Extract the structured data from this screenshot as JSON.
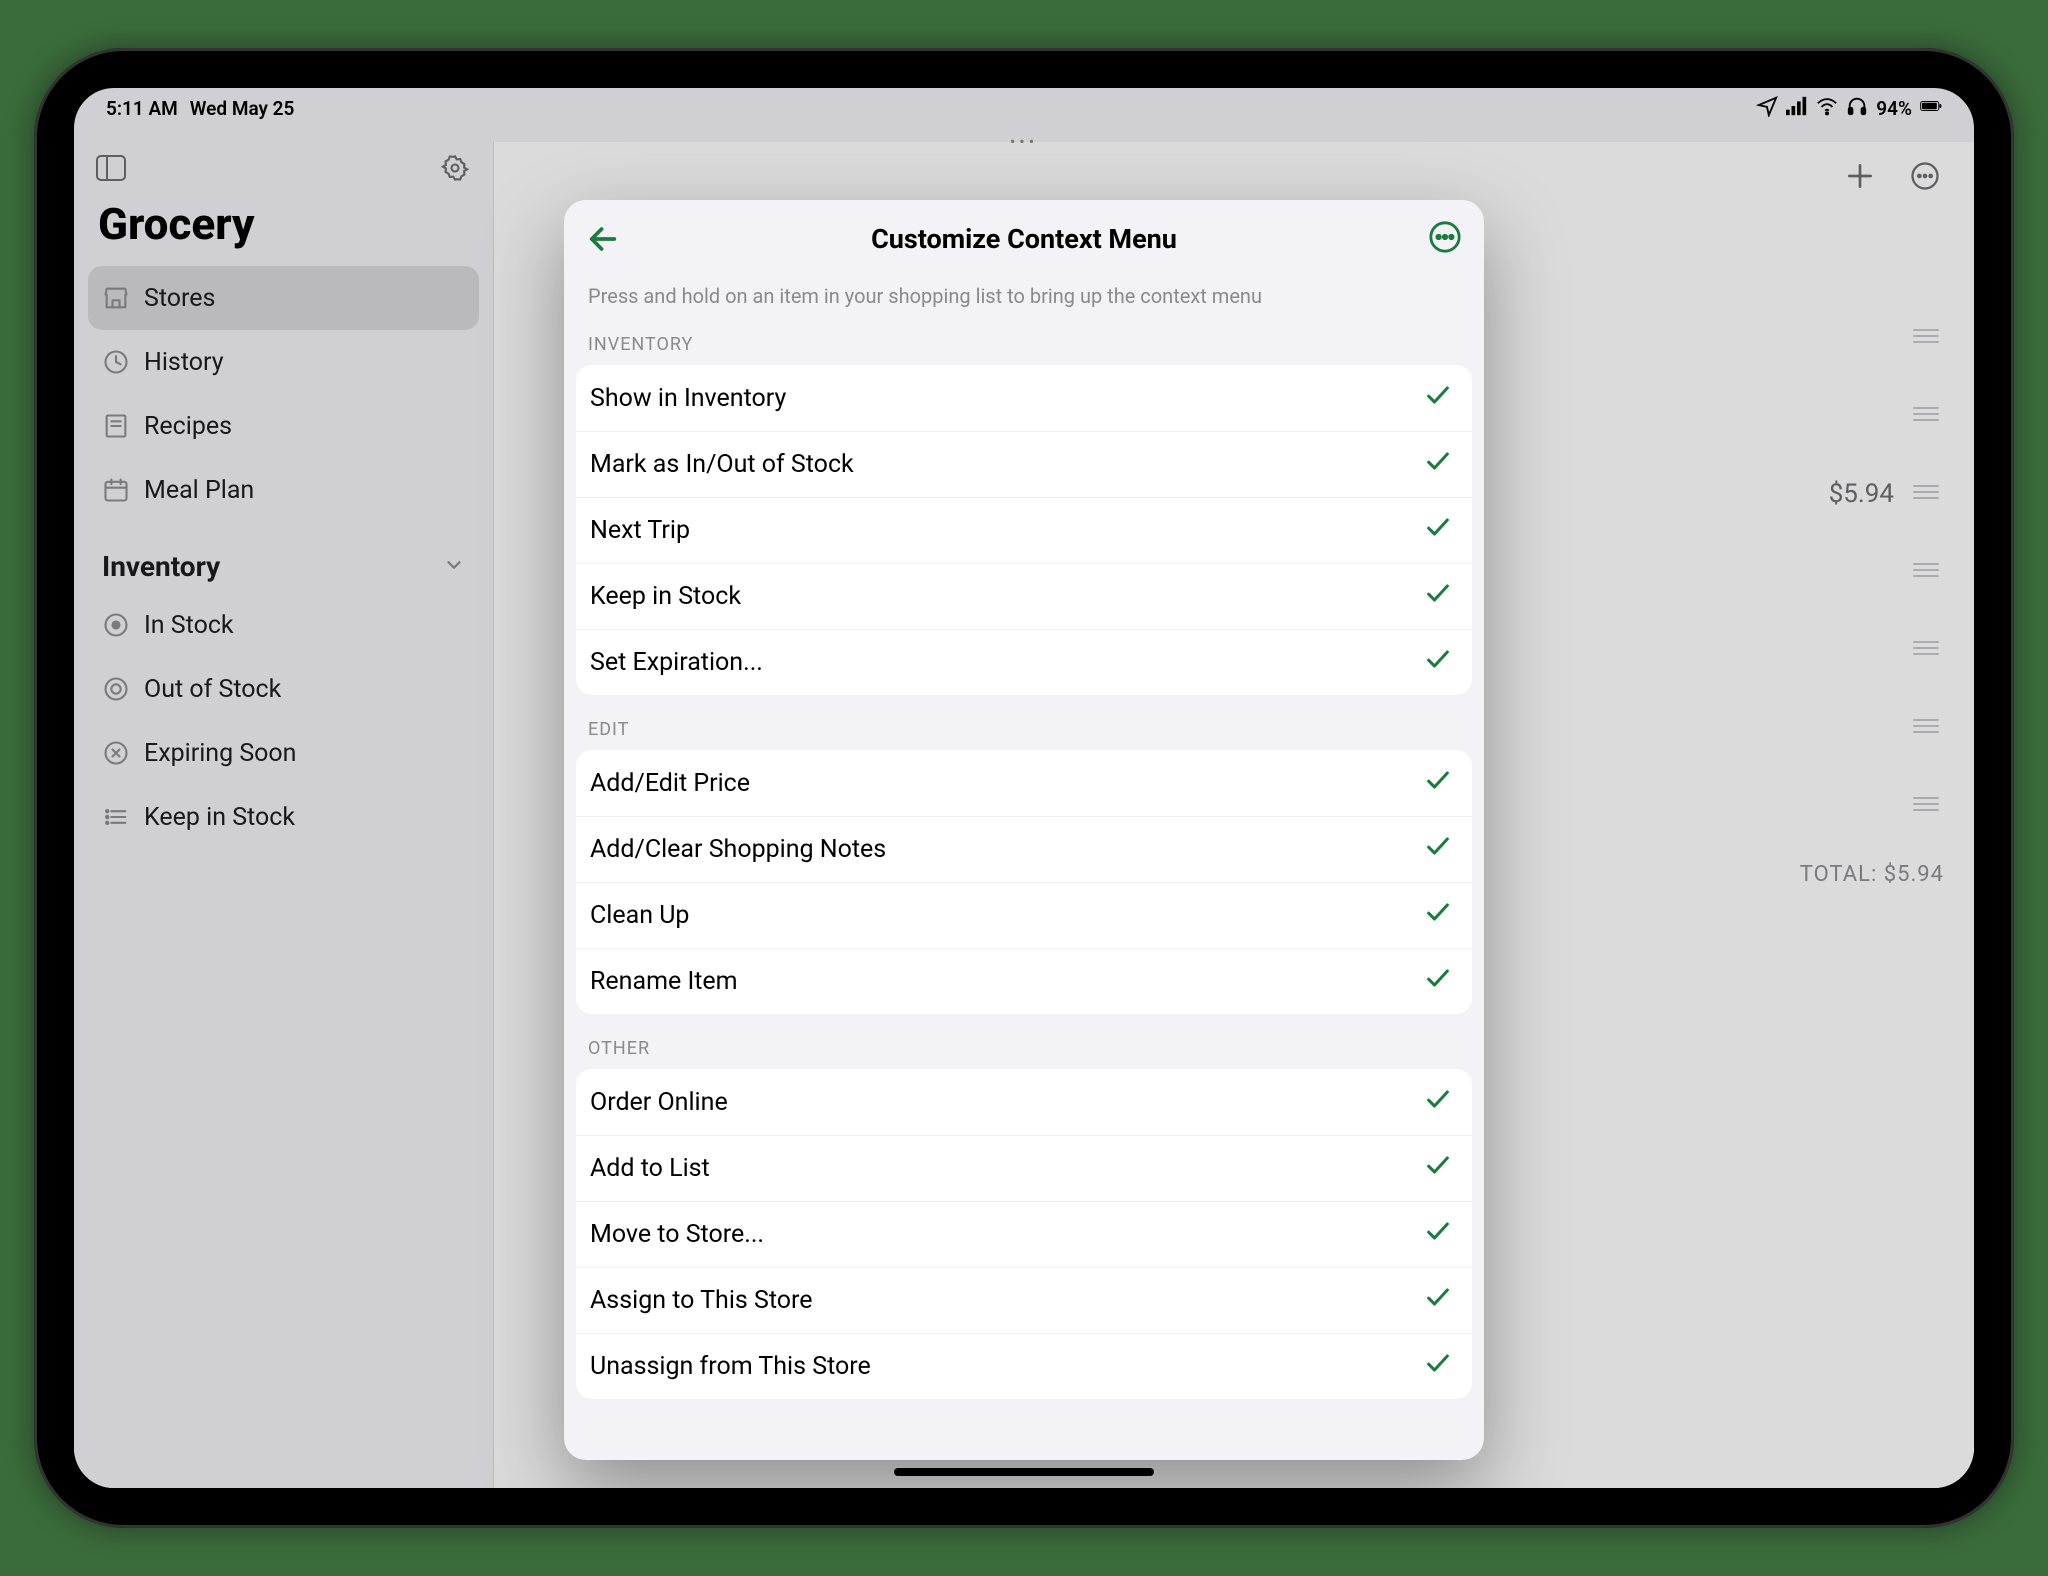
{
  "status": {
    "time": "5:11 AM",
    "date": "Wed May 25",
    "battery_pct": "94%"
  },
  "sidebar": {
    "title": "Grocery",
    "items": [
      {
        "label": "Stores",
        "icon": "store-icon",
        "selected": true
      },
      {
        "label": "History",
        "icon": "clock-icon",
        "selected": false
      },
      {
        "label": "Recipes",
        "icon": "book-icon",
        "selected": false
      },
      {
        "label": "Meal Plan",
        "icon": "calendar-icon",
        "selected": false
      }
    ],
    "inventory_header": "Inventory",
    "inventory_items": [
      {
        "label": "In Stock",
        "icon": "circle-dot-icon"
      },
      {
        "label": "Out of Stock",
        "icon": "circle-ring-icon"
      },
      {
        "label": "Expiring Soon",
        "icon": "x-circle-icon"
      },
      {
        "label": "Keep in Stock",
        "icon": "list-icon"
      }
    ]
  },
  "main": {
    "price_row_value": "$5.94",
    "total_label": "TOTAL: $5.94"
  },
  "modal": {
    "title": "Customize Context Menu",
    "subtitle": "Press and hold on an item in your shopping list to bring up the context menu",
    "sections": [
      {
        "header": "INVENTORY",
        "items": [
          "Show in Inventory",
          "Mark as In/Out of Stock",
          "Next Trip",
          "Keep in Stock",
          "Set Expiration..."
        ]
      },
      {
        "header": "EDIT",
        "items": [
          "Add/Edit Price",
          "Add/Clear Shopping Notes",
          "Clean Up",
          "Rename Item"
        ]
      },
      {
        "header": "OTHER",
        "items": [
          "Order Online",
          "Add to List",
          "Move to Store...",
          "Assign to This Store",
          "Unassign from This Store"
        ]
      }
    ]
  }
}
